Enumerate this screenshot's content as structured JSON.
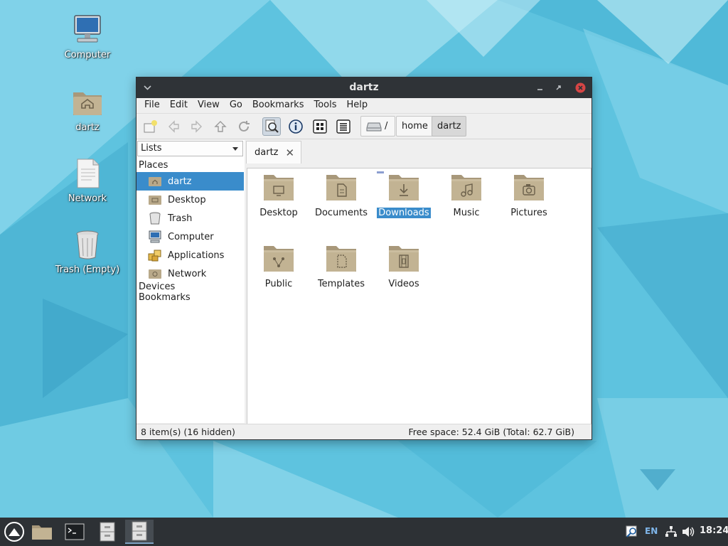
{
  "desktop": {
    "icons": [
      {
        "label": "Computer"
      },
      {
        "label": "dartz"
      },
      {
        "label": "Network"
      },
      {
        "label": "Trash (Empty)"
      }
    ]
  },
  "window": {
    "title": "dartz",
    "menu": [
      "File",
      "Edit",
      "View",
      "Go",
      "Bookmarks",
      "Tools",
      "Help"
    ],
    "breadcrumbs": [
      "/",
      "home",
      "dartz"
    ]
  },
  "sidepane": {
    "selector": "Lists",
    "places_heading": "Places",
    "places": [
      "dartz",
      "Desktop",
      "Trash",
      "Computer",
      "Applications",
      "Network"
    ],
    "devices_heading": "Devices",
    "bookmarks_heading": "Bookmarks"
  },
  "tab": {
    "label": "dartz"
  },
  "files": [
    {
      "name": "Desktop",
      "emblem": "desktop"
    },
    {
      "name": "Documents",
      "emblem": "document"
    },
    {
      "name": "Downloads",
      "emblem": "download"
    },
    {
      "name": "Music",
      "emblem": "music"
    },
    {
      "name": "Pictures",
      "emblem": "camera"
    },
    {
      "name": "Public",
      "emblem": "share"
    },
    {
      "name": "Templates",
      "emblem": "template"
    },
    {
      "name": "Videos",
      "emblem": "film"
    }
  ],
  "status": {
    "left": "8 item(s) (16 hidden)",
    "right": "Free space: 52.4 GiB (Total: 62.7 GiB)"
  },
  "tray": {
    "lang": "EN",
    "clock": "18:24"
  },
  "colors": {
    "selection": "#3a8ccb",
    "titlebar": "#2f3337",
    "close_button": "#d64545",
    "folder": "#b9a98a"
  }
}
